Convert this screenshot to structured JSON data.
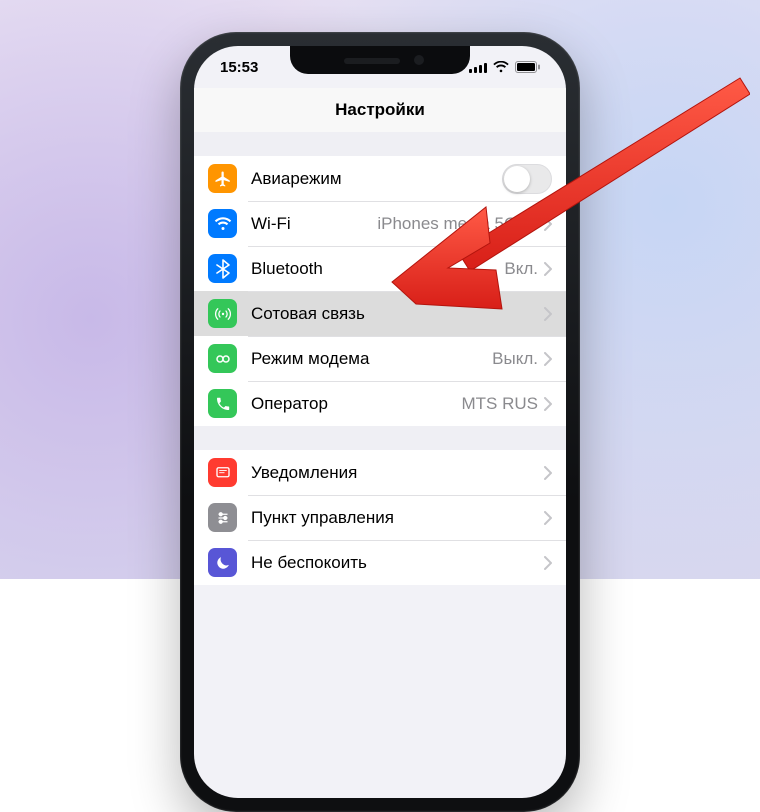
{
  "status": {
    "time": "15:53"
  },
  "header": {
    "title": "Настройки"
  },
  "groups": [
    {
      "rows": [
        {
          "id": "airplane",
          "label": "Авиарежим",
          "detail": "",
          "accessory": "switch",
          "iconColor": "#ff9500",
          "iconName": "airplane-icon"
        },
        {
          "id": "wifi",
          "label": "Wi-Fi",
          "detail": "iPhones media 5GHz",
          "accessory": "chevron",
          "iconColor": "#007aff",
          "iconName": "wifi-icon"
        },
        {
          "id": "bluetooth",
          "label": "Bluetooth",
          "detail": "Вкл.",
          "accessory": "chevron",
          "iconColor": "#007aff",
          "iconName": "bluetooth-icon"
        },
        {
          "id": "cellular",
          "label": "Сотовая связь",
          "detail": "",
          "accessory": "chevron",
          "iconColor": "#34c759",
          "iconName": "cellular-icon",
          "highlight": true
        },
        {
          "id": "hotspot",
          "label": "Режим модема",
          "detail": "Выкл.",
          "accessory": "chevron",
          "iconColor": "#34c759",
          "iconName": "hotspot-icon"
        },
        {
          "id": "carrier",
          "label": "Оператор",
          "detail": "MTS RUS",
          "accessory": "chevron",
          "iconColor": "#34c759",
          "iconName": "carrier-icon"
        }
      ]
    },
    {
      "rows": [
        {
          "id": "notifications",
          "label": "Уведомления",
          "detail": "",
          "accessory": "chevron",
          "iconColor": "#ff3b30",
          "iconName": "notifications-icon"
        },
        {
          "id": "controlcenter",
          "label": "Пункт управления",
          "detail": "",
          "accessory": "chevron",
          "iconColor": "#8e8e93",
          "iconName": "control-center-icon"
        },
        {
          "id": "dnd",
          "label": "Не беспокоить",
          "detail": "",
          "accessory": "chevron",
          "iconColor": "#5856d6",
          "iconName": "dnd-icon"
        }
      ]
    }
  ]
}
